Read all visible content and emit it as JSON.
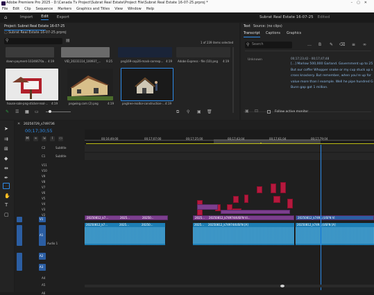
{
  "title_bar": {
    "text": "Adobe Premiere Pro 2025 - D:\\Canada Tv Project\\Subrat Real Estate\\Project File\\Subrat Real Estate 16-07-25.prproj *"
  },
  "menu": [
    "File",
    "Edit",
    "Clip",
    "Sequence",
    "Markers",
    "Graphics and Titles",
    "View",
    "Window",
    "Help"
  ],
  "workspace": {
    "tabs": [
      "Import",
      "Edit",
      "Export"
    ],
    "active": "Edit",
    "project_name": "Subrat Real Estate 16-07-25",
    "status": "Edited"
  },
  "project_panel": {
    "tab_label": "Project: Subrat Real Estate 16-07-25",
    "bin_path": "Subrat Real Estate 16-07-25.prproj",
    "items_selected": "1 of 239 items selected",
    "top_row_captions": [
      {
        "name": "down-payment-10246670a...",
        "dur": "4:19"
      },
      {
        "name": "VID_20231114_100937_...",
        "dur": "9:25"
      },
      {
        "name": "png169-cop26-mask-corresp...",
        "dur": "4:19"
      },
      {
        "name": "Adobe Express - file (10).png",
        "dur": "4:19"
      }
    ],
    "bottom_row_captions": [
      {
        "name": "house-sale-png-sticker-real-...",
        "dur": "4:19"
      },
      {
        "name": "pngwing.com (2).png",
        "dur": "4:19"
      },
      {
        "name": "pngtree-realtor-construction-...",
        "dur": "4:19"
      }
    ]
  },
  "text_panel": {
    "tabs": [
      "Text",
      "Source: (no clips)"
    ],
    "subtabs": [
      "Transcript",
      "Captions",
      "Graphics"
    ],
    "search_placeholder": "Search",
    "segment_time": "00;17;23;42 - 00;17;47;48",
    "speaker": "Unknown",
    "transcript": "[...] Marlow 500,000 Garland. Government up to 25 But our coffer Whopper snake or my cup stuck up s cross knackery. But remember, when you're up for value more than I example. Well he pipe hundred G Bunn gap got 1 million.",
    "follow_label": "Follow active monitor"
  },
  "timeline": {
    "sequence_tab": "20250729_s749736",
    "timecode": "00;17;30;55",
    "ruler_ticks": [
      "00;16;49;00",
      "00;17;07;00",
      "00;17;25;00",
      "00;17;43;04",
      "00;17;61;04",
      "00;17;79;04"
    ],
    "tracks_video": [
      "C2",
      "C1",
      "V11",
      "V10",
      "V9",
      "V8",
      "V7",
      "V6",
      "V5",
      "V4",
      "V3",
      "V2",
      "V1"
    ],
    "subtitle_label": "Subtitle",
    "tracks_audio": [
      "A1",
      "A2",
      "A3",
      "A4",
      "A5",
      "A6"
    ],
    "audio_track_name": "Audio 1",
    "clip_v1_names": [
      "20250812_k7...",
      "2025...",
      "20250...",
      "2025...",
      "20250812_k749744USFN Vi...",
      "20250812_k749...(USFN Vi"
    ],
    "clip_a1_names": [
      "20250812_k7...",
      "2025...",
      "20250...",
      "2025...",
      "20250812_k749744USFN [A]",
      "20250812_k749...(USFN [A]"
    ]
  },
  "colors": {
    "accent": "#2d8ceb",
    "video_clip": "#7c3f8e",
    "audio_clip": "#1d7eb5",
    "red_clip": "#b5193e",
    "playhead": "#2d8ceb",
    "bg": "#1d1d1d"
  }
}
